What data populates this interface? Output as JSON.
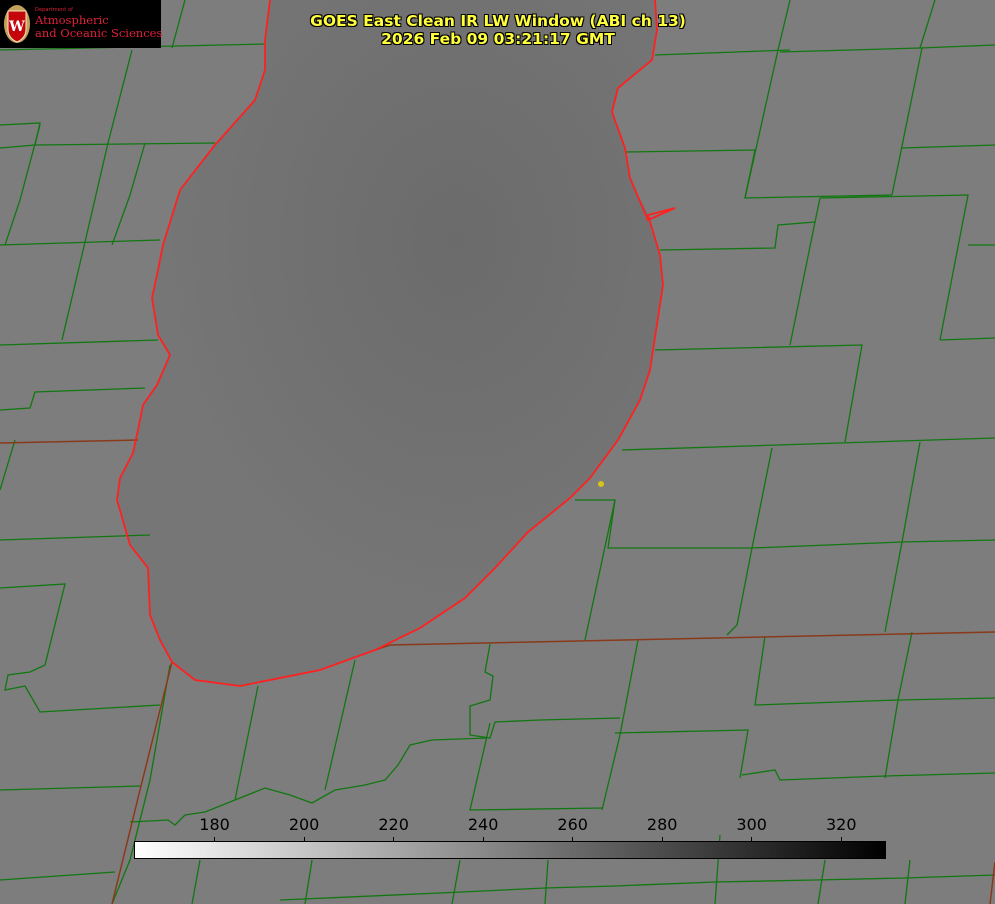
{
  "title": {
    "line1": "GOES East Clean IR LW Window (ABI ch 13)",
    "line2": "2026 Feb 09 03:21:17 GMT"
  },
  "logo": {
    "lettering": "Department of Atmospheric and Oceanic Sciences",
    "line1": "Atmospheric",
    "line2": "and Oceanic Sciences",
    "crest_letter": "W"
  },
  "colorbar": {
    "ticks": [
      "180",
      "200",
      "220",
      "240",
      "260",
      "280",
      "300",
      "320"
    ],
    "min_value": 162,
    "max_value": 330,
    "tick_values": [
      180,
      200,
      220,
      240,
      260,
      280,
      300,
      320
    ],
    "color_low": "#ffffff",
    "color_high": "#000000"
  },
  "colors": {
    "land": "#7d7d7d",
    "lake": "#6e6e6e",
    "county_lines": "#117711",
    "coastline": "#ff2020",
    "title_text": "#ffff3c",
    "marker": "#d9c21a"
  }
}
